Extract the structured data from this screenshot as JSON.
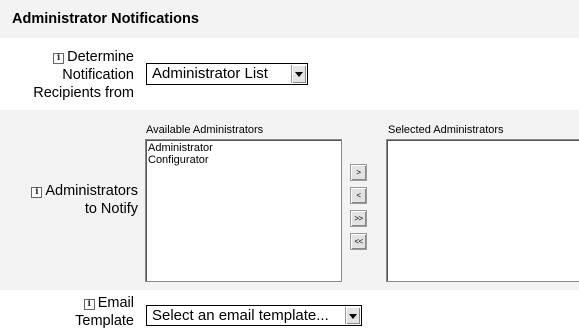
{
  "header": {
    "title": "Administrator Notifications"
  },
  "recipients": {
    "label_lines": [
      "Determine",
      "Notification",
      "Recipients from"
    ],
    "selected": "Administrator List"
  },
  "administrators": {
    "label_lines": [
      "Administrators",
      "to Notify"
    ],
    "available_title": "Available Administrators",
    "available_items": [
      "Administrator",
      "Configurator"
    ],
    "selected_title": "Selected Administrators",
    "selected_items": [],
    "buttons": {
      "add": ">",
      "remove": "<",
      "add_all": ">>",
      "remove_all": "<<"
    }
  },
  "email_template": {
    "label_lines": [
      "Email",
      "Template"
    ],
    "selected": "Select an email template..."
  },
  "icons": {
    "info": "info-icon"
  }
}
